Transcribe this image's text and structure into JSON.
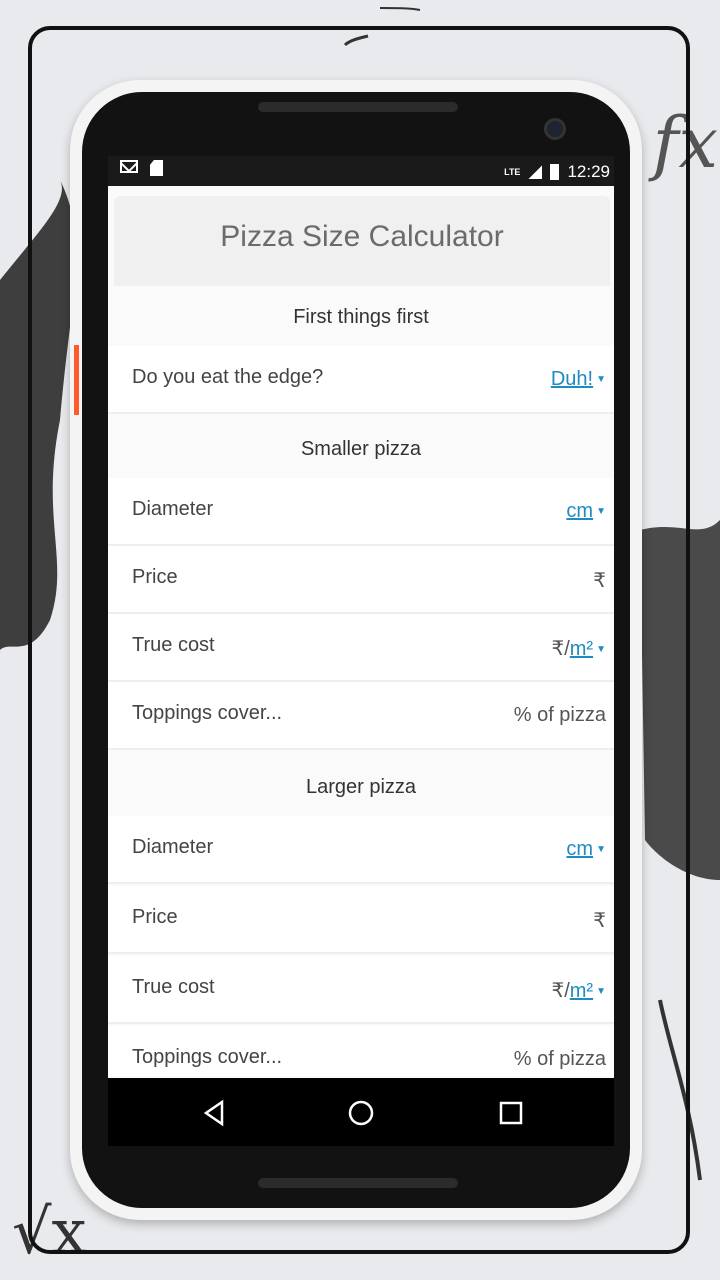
{
  "statusbar": {
    "network": "LTE",
    "time": "12:29"
  },
  "app": {
    "title": "Pizza Size Calculator"
  },
  "sections": [
    {
      "title": "First things first",
      "rows": [
        {
          "label": "Do you eat the edge?",
          "value": "Duh!",
          "has_dropdown": true
        }
      ]
    },
    {
      "title": "Smaller pizza",
      "rows": [
        {
          "label": "Diameter",
          "unit": "cm"
        },
        {
          "label": "Price",
          "unit": "₹"
        },
        {
          "label": "True cost",
          "unit_prefix": "₹/",
          "unit": "m²"
        },
        {
          "label": "Toppings cover...",
          "unit": "% of pizza"
        }
      ]
    },
    {
      "title": "Larger pizza",
      "rows": [
        {
          "label": "Diameter",
          "unit": "cm"
        },
        {
          "label": "Price",
          "unit": "₹"
        },
        {
          "label": "True cost",
          "unit_prefix": "₹/",
          "unit": "m²"
        },
        {
          "label": "Toppings cover...",
          "unit": "% of pizza"
        }
      ]
    }
  ],
  "background": {
    "fx_text": "fx",
    "sqrt_text": "√x"
  },
  "colors": {
    "link": "#1e8bc3",
    "accent_button": "#ff5a2c"
  }
}
